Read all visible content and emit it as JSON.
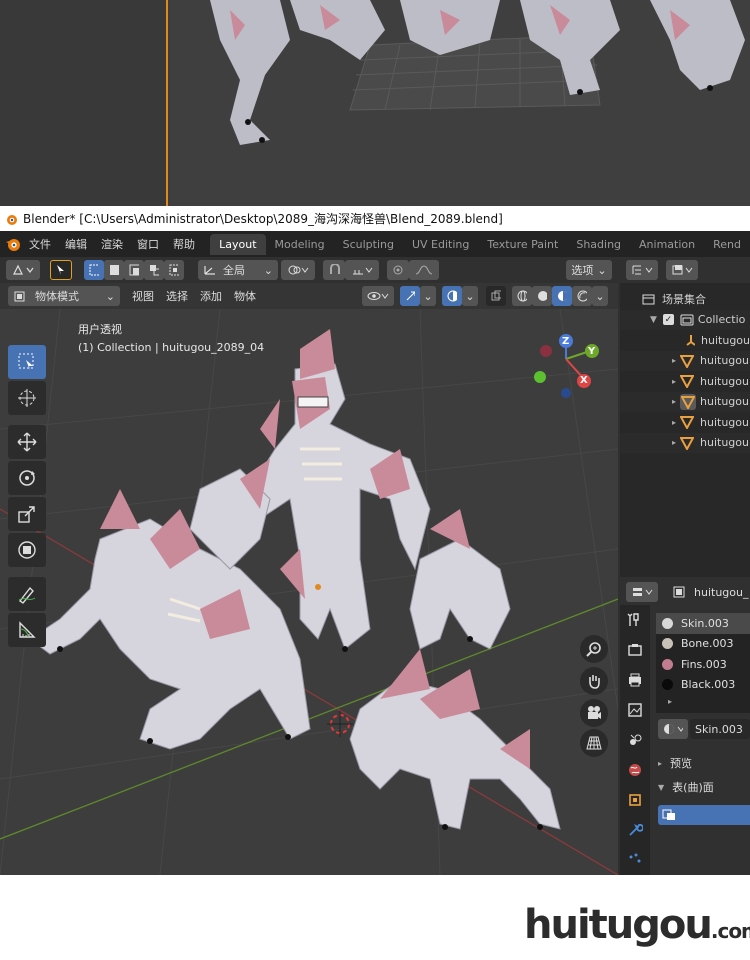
{
  "titlebar": {
    "title": "Blender* [C:\\Users\\Administrator\\Desktop\\2089_海沟深海怪兽\\Blend_2089.blend]"
  },
  "menubar": {
    "menus": [
      "文件",
      "编辑",
      "渲染",
      "窗口",
      "帮助"
    ],
    "tabs": [
      "Layout",
      "Modeling",
      "Sculpting",
      "UV Editing",
      "Texture Paint",
      "Shading",
      "Animation",
      "Rend"
    ],
    "active_tab": "Layout"
  },
  "viewport": {
    "header1": {
      "orientation": "全局",
      "options_label": "选项"
    },
    "header2": {
      "mode": "物体模式",
      "menus": [
        "视图",
        "选择",
        "添加",
        "物体"
      ]
    },
    "view_name": "用户透视",
    "collection_info": "(1) Collection | huitugou_2089_04",
    "gizmo": {
      "z": "Z",
      "y": "Y",
      "x": "X"
    }
  },
  "outliner": {
    "root": "场景集合",
    "collection": "Collectio",
    "items": [
      "huitugou",
      "huitugou",
      "huitugou",
      "huitugou",
      "huitugou",
      "huitugou"
    ]
  },
  "properties": {
    "object": "huitugou_",
    "materials": [
      {
        "name": "Skin.003",
        "color": "#d8d8d8"
      },
      {
        "name": "Bone.003",
        "color": "#c9c2b8"
      },
      {
        "name": "Fins.003",
        "color": "#c27d90"
      },
      {
        "name": "Black.003",
        "color": "#0a0a0a"
      }
    ],
    "active_material": "Skin.003",
    "sections": [
      "预览",
      "表(曲)面"
    ]
  },
  "watermark": {
    "main": "huitugou",
    "suffix": ".com"
  }
}
